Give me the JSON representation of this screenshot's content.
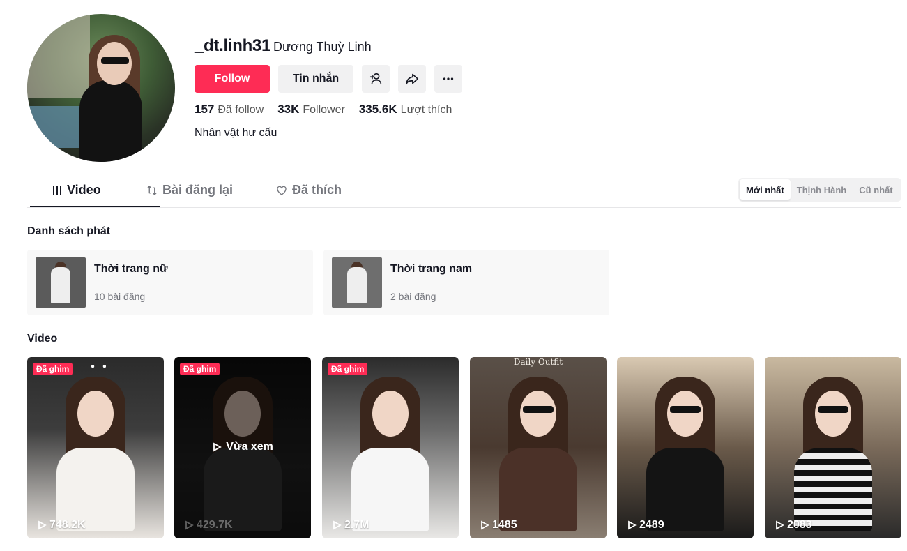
{
  "profile": {
    "username": "_dt.linh31",
    "nickname": "Dương Thuỳ Linh",
    "bio": "Nhân vật hư cấu",
    "buttons": {
      "follow": "Follow",
      "message": "Tin nhắn"
    },
    "stats": {
      "following_count": "157",
      "following_label": "Đã follow",
      "followers_count": "33K",
      "followers_label": "Follower",
      "likes_count": "335.6K",
      "likes_label": "Lượt thích"
    }
  },
  "tabs": {
    "video": "Video",
    "repost": "Bài đăng lại",
    "liked": "Đã thích"
  },
  "sort": {
    "latest": "Mới nhất",
    "trending": "Thịnh Hành",
    "oldest": "Cũ nhất"
  },
  "playlists": {
    "title": "Danh sách phát",
    "items": [
      {
        "name": "Thời trang nữ",
        "count": "10 bài đăng"
      },
      {
        "name": "Thời trang nam",
        "count": "2 bài đăng"
      }
    ]
  },
  "videos": {
    "title": "Video",
    "pinned_label": "Đã ghim",
    "watched_label": "Vừa xem",
    "daily_caption": "Daily Outfit",
    "items": [
      {
        "views": "748.2K"
      },
      {
        "views": "429.7K"
      },
      {
        "views": "2.7M"
      },
      {
        "views": "1485"
      },
      {
        "views": "2489"
      },
      {
        "views": "2083"
      }
    ]
  },
  "colors": {
    "accent": "#fe2c55",
    "text": "#161823",
    "secondary_bg": "#f1f1f2"
  }
}
